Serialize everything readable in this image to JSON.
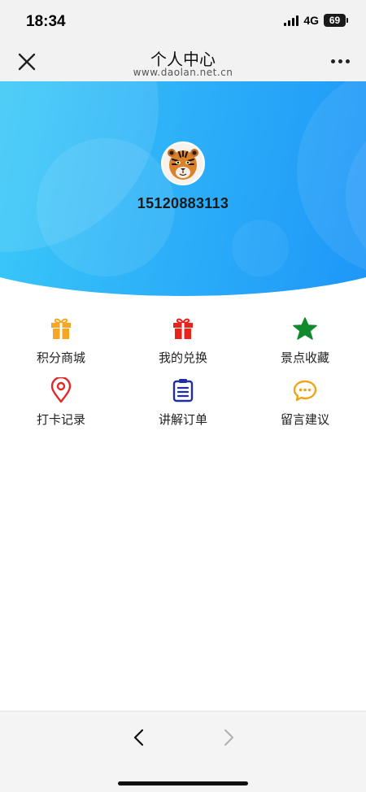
{
  "status_bar": {
    "time": "18:34",
    "network": "4G",
    "battery": "69"
  },
  "nav": {
    "title": "个人中心",
    "subtitle": "www.daolan.net.cn"
  },
  "profile": {
    "phone": "15120883113"
  },
  "menu": [
    {
      "label": "积分商城",
      "icon": "gift-icon",
      "color": "#f5a623"
    },
    {
      "label": "我的兑换",
      "icon": "gift-icon",
      "color": "#e8231c"
    },
    {
      "label": "景点收藏",
      "icon": "star-icon",
      "color": "#118a2e"
    },
    {
      "label": "打卡记录",
      "icon": "location-pin-icon",
      "color": "#e22a2a"
    },
    {
      "label": "讲解订单",
      "icon": "clipboard-list-icon",
      "color": "#1f2f9e"
    },
    {
      "label": "留言建议",
      "icon": "chat-bubble-icon",
      "color": "#f0a418"
    }
  ],
  "colors": {
    "banner_start": "#3fd2f7",
    "banner_end": "#1a8ff8",
    "bar_background": "#f2f2f2"
  }
}
